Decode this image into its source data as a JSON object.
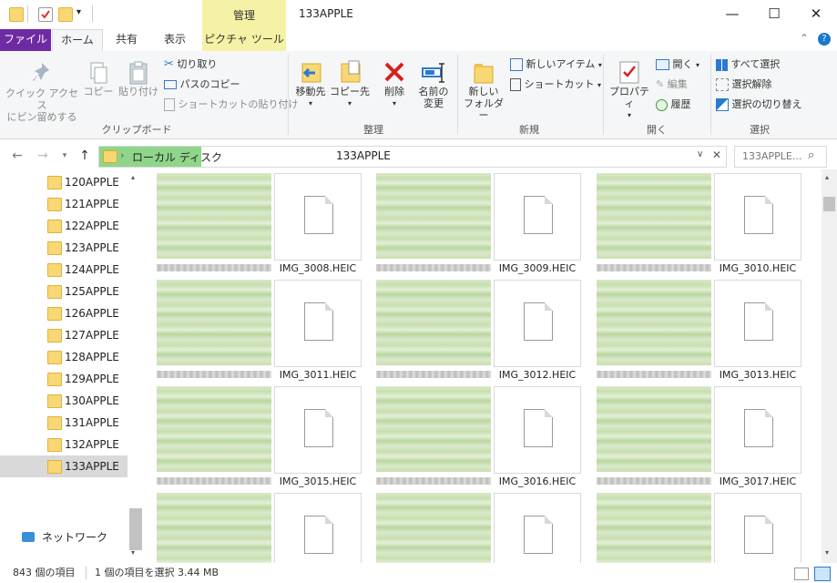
{
  "window": {
    "title": "133APPLE",
    "context_tab": "管理",
    "controls": {
      "minimize": "—",
      "maximize": "☐",
      "close": "✕"
    }
  },
  "ribbon_tabs": {
    "file": "ファイル",
    "home": "ホーム",
    "share": "共有",
    "view": "表示",
    "picture_tools": "ピクチャ ツール"
  },
  "clipboard": {
    "pin": "クイック アクセス\nにピン留めする",
    "copy": "コピー",
    "paste": "貼り付け",
    "cut": "切り取り",
    "copy_path": "パスのコピー",
    "paste_shortcut": "ショートカットの貼り付け",
    "label": "クリップボード"
  },
  "organize": {
    "move_to": "移動先",
    "copy_to": "コピー先",
    "delete": "削除",
    "rename": "名前の\n変更",
    "label": "整理"
  },
  "new": {
    "new_folder": "新しい\nフォルダー",
    "new_item": "新しいアイテム",
    "shortcut": "ショートカット",
    "label": "新規"
  },
  "open": {
    "properties": "プロパティ",
    "open": "開く",
    "edit": "編集",
    "history": "履歴",
    "label": "開く"
  },
  "select": {
    "select_all": "すべて選択",
    "select_none": "選択解除",
    "invert": "選択の切り替え",
    "label": "選択"
  },
  "address": {
    "root": "ローカル ディスク",
    "current": "133APPLE",
    "search_placeholder": "133APPLE..."
  },
  "nav": {
    "folders": [
      "120APPLE",
      "121APPLE",
      "122APPLE",
      "123APPLE",
      "124APPLE",
      "125APPLE",
      "126APPLE",
      "127APPLE",
      "128APPLE",
      "129APPLE",
      "130APPLE",
      "131APPLE",
      "132APPLE",
      "133APPLE"
    ],
    "selected": "133APPLE",
    "network": "ネットワーク"
  },
  "files": [
    [
      "IMG_3008.HEIC",
      "IMG_3009.HEIC",
      "IMG_3010.HEIC"
    ],
    [
      "IMG_3011.HEIC",
      "IMG_3012.HEIC",
      "IMG_3013.HEIC"
    ],
    [
      "IMG_3015.HEIC",
      "IMG_3016.HEIC",
      "IMG_3017.HEIC"
    ],
    [
      "",
      "",
      ""
    ]
  ],
  "status": {
    "count": "843 個の項目",
    "selection": "1 個の項目を選択  3.44 MB"
  },
  "colors": {
    "file_tab": "#6d2aa3",
    "picture_tools": "#f6f2a5",
    "address_highlight": "#8fd68a"
  }
}
